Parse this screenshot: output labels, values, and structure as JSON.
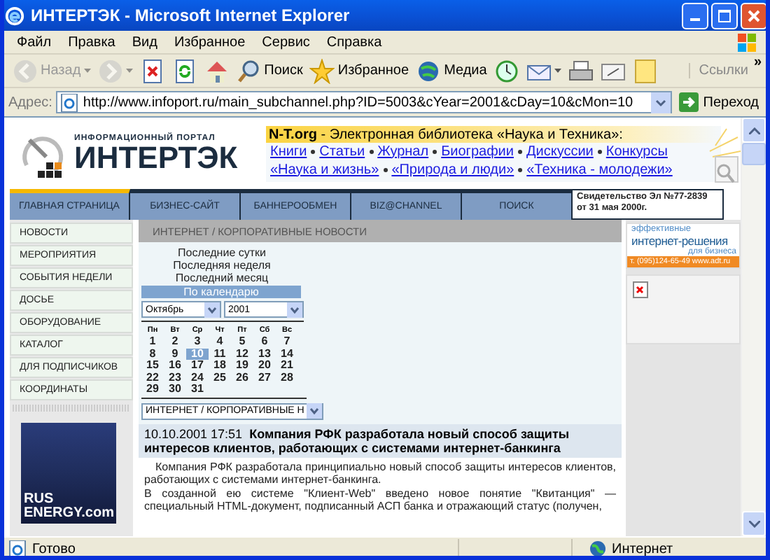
{
  "window": {
    "title": "ИНТЕРТЭК - Microsoft Internet Explorer"
  },
  "menu": [
    "Файл",
    "Правка",
    "Вид",
    "Избранное",
    "Сервис",
    "Справка"
  ],
  "toolbar": [
    {
      "kind": "back",
      "label": "Назад",
      "disabled": true,
      "dropdown": true
    },
    {
      "kind": "forward",
      "disabled": true,
      "dropdown": true
    },
    {
      "kind": "stop",
      "disabled": false
    },
    {
      "kind": "refresh",
      "disabled": false
    },
    {
      "kind": "home",
      "disabled": false
    },
    {
      "kind": "search",
      "label": "Поиск",
      "disabled": false
    },
    {
      "kind": "favorites",
      "label": "Избранное",
      "disabled": false
    },
    {
      "kind": "media",
      "label": "Медиа",
      "disabled": false
    },
    {
      "kind": "history",
      "disabled": false
    },
    {
      "kind": "mail",
      "disabled": false,
      "dropdown": true
    },
    {
      "kind": "print",
      "disabled": false
    },
    {
      "kind": "edit",
      "disabled": false
    },
    {
      "kind": "notes",
      "disabled": false
    }
  ],
  "links_label": "Ссылки",
  "links_more": "»",
  "address": {
    "label": "Адрес:",
    "value": "http://www.infoport.ru/main_subchannel.php?ID=5003&cYear=2001&cDay=10&cMon=10",
    "go": "Переход"
  },
  "logo": {
    "tagline": "ИНФОРМАЦИОННЫЙ ПОРТАЛ",
    "name": "ИНТЕРТЭК"
  },
  "library": {
    "site": "N-T.org",
    "title": " - Электронная библиотека «Наука и Техника»:",
    "links_row_1": [
      "Книги",
      "Статьи",
      "Журнал",
      "Биографии",
      "Дискуссии",
      "Конкурсы"
    ],
    "links_row_2": [
      "«Наука и жизнь»",
      "«Природа и люди»",
      "«Техника - молодежи»"
    ]
  },
  "nav": [
    {
      "label": "ГЛАВНАЯ СТРАНИЦА",
      "selected": true
    },
    {
      "label": "БИЗНЕС-САЙТ",
      "selected": false
    },
    {
      "label": "БАННЕРООБМЕН",
      "selected": false
    },
    {
      "label": "BIZ@CHANNEL",
      "selected": false
    },
    {
      "label": "ПОИСК",
      "selected": false
    }
  ],
  "certificate": "Свидетельство Эл №77-2839 от 31 мая 2000г.",
  "sidebar": [
    "НОВОСТИ",
    "МЕРОПРИЯТИЯ",
    "СОБЫТИЯ НЕДЕЛИ",
    "ДОСЬЕ",
    "ОБОРУДОВАНИЕ",
    "КАТАЛОГ",
    "ДЛЯ ПОДПИСЧИКОВ",
    "КООРДИНАТЫ"
  ],
  "banner": {
    "line_1": "RUS",
    "line_2": "ENERGY.com"
  },
  "section_title": "ИНТЕРНЕТ / КОРПОРАТИВНЫЕ НОВОСТИ",
  "periods": [
    "Последние сутки",
    "Последняя неделя",
    "Последний месяц"
  ],
  "calendar_link": "По календарю",
  "month_select": "Октябрь",
  "year_select": "2001",
  "weekdays": [
    "Пн",
    "Вт",
    "Ср",
    "Чт",
    "Пт",
    "Сб",
    "Вс"
  ],
  "days": [
    {
      "d": "1",
      "selected": false
    },
    {
      "d": "2",
      "selected": false
    },
    {
      "d": "3",
      "selected": false
    },
    {
      "d": "4",
      "selected": false
    },
    {
      "d": "5",
      "selected": false
    },
    {
      "d": "6",
      "selected": false
    },
    {
      "d": "7",
      "selected": false
    },
    {
      "d": "8",
      "selected": false
    },
    {
      "d": "9",
      "selected": false
    },
    {
      "d": "10",
      "selected": true
    },
    {
      "d": "11",
      "selected": false
    },
    {
      "d": "12",
      "selected": false
    },
    {
      "d": "13",
      "selected": false
    },
    {
      "d": "14",
      "selected": false
    },
    {
      "d": "15",
      "selected": false
    },
    {
      "d": "16",
      "selected": false
    },
    {
      "d": "17",
      "selected": false
    },
    {
      "d": "18",
      "selected": false
    },
    {
      "d": "19",
      "selected": false
    },
    {
      "d": "20",
      "selected": false
    },
    {
      "d": "21",
      "selected": false
    },
    {
      "d": "22",
      "selected": false
    },
    {
      "d": "23",
      "selected": false
    },
    {
      "d": "24",
      "selected": false
    },
    {
      "d": "25",
      "selected": false
    },
    {
      "d": "26",
      "selected": false
    },
    {
      "d": "27",
      "selected": false
    },
    {
      "d": "28",
      "selected": false
    },
    {
      "d": "29",
      "selected": false
    },
    {
      "d": "30",
      "selected": false
    },
    {
      "d": "31",
      "selected": false
    }
  ],
  "channel_select": "ИНТЕРНЕТ / КОРПОРАТИВНЫЕ Н",
  "article": {
    "date": "10.10.2001 17:51",
    "headline": "Компания РФК разработала новый способ защиты интересов клиентов, работающих с системами интернет-банкинга",
    "paragraphs": [
      "Компания РФК разработала принципиально новый способ защиты интересов клиентов, работающих с системами интернет-банкинга.",
      "В созданной ею системе \"Клиент-Web\" введено новое понятие \"Квитанция\" — специальный HTML-документ, подписанный АСП банка и отражающий статус (получен,"
    ]
  },
  "ad": {
    "line_1": "эффективные",
    "line_2": "интернет-решения",
    "line_3": "для бизнеса",
    "contacts": "т. (095)124-65-49  www.adt.ru"
  },
  "status_bar": {
    "text": "Готово",
    "zone": "Интернет"
  }
}
